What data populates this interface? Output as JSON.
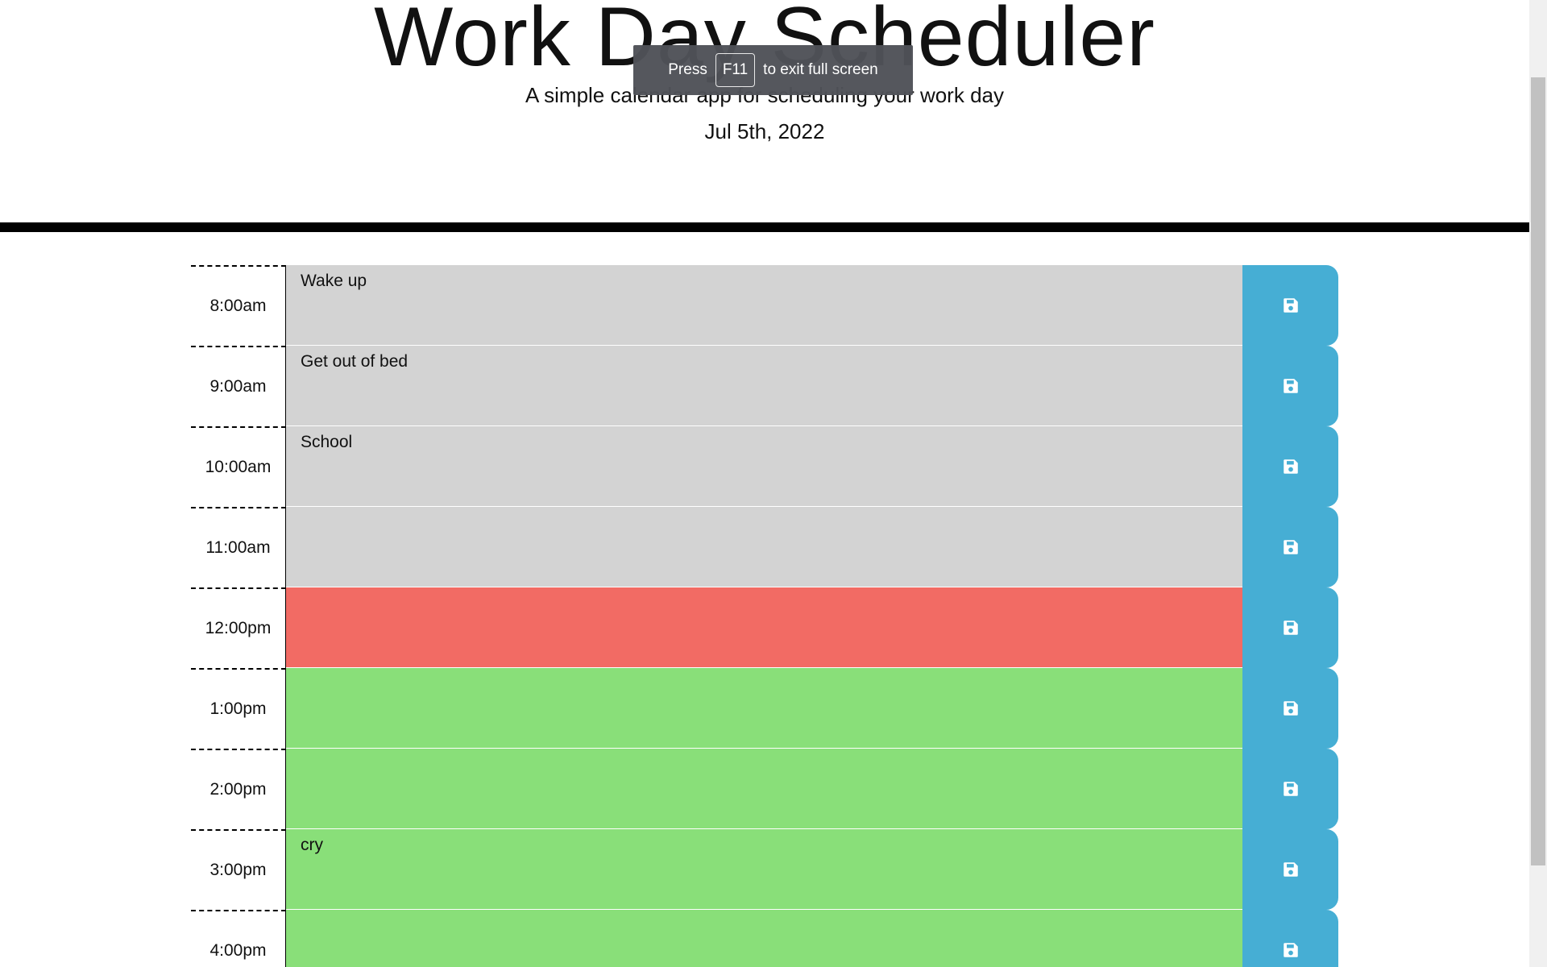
{
  "header": {
    "title": "Work Day Scheduler",
    "lead": "A simple calendar app for scheduling your work day",
    "current_day": "Jul 5th, 2022"
  },
  "fullscreen_notice": {
    "press": "Press",
    "key": "F11",
    "rest": "to exit full screen"
  },
  "colors": {
    "past": "#d3d3d3",
    "present": "#f26b64",
    "future": "#89df79",
    "save_button": "#46aed4"
  },
  "time_blocks": [
    {
      "hour": "8:00am",
      "text": "Wake up",
      "state": "past",
      "save_icon": "floppy-disk-icon"
    },
    {
      "hour": "9:00am",
      "text": "Get out of bed",
      "state": "past",
      "save_icon": "floppy-disk-icon"
    },
    {
      "hour": "10:00am",
      "text": "School",
      "state": "past",
      "save_icon": "floppy-disk-icon"
    },
    {
      "hour": "11:00am",
      "text": "",
      "state": "past",
      "save_icon": "floppy-disk-icon"
    },
    {
      "hour": "12:00pm",
      "text": "",
      "state": "present",
      "save_icon": "floppy-disk-icon"
    },
    {
      "hour": "1:00pm",
      "text": "",
      "state": "future",
      "save_icon": "floppy-disk-icon"
    },
    {
      "hour": "2:00pm",
      "text": "",
      "state": "future",
      "save_icon": "floppy-disk-icon"
    },
    {
      "hour": "3:00pm",
      "text": "cry",
      "state": "future",
      "save_icon": "floppy-disk-icon"
    },
    {
      "hour": "4:00pm",
      "text": "",
      "state": "future",
      "save_icon": "floppy-disk-icon"
    }
  ]
}
